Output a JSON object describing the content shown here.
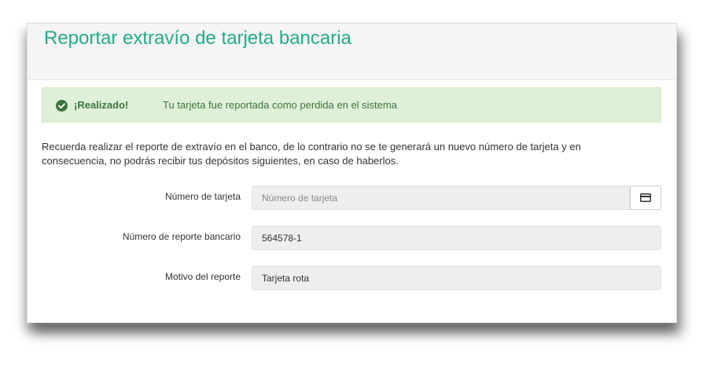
{
  "header": {
    "title": "Reportar extravío de tarjeta bancaria"
  },
  "alert": {
    "icon": "check-circle-icon",
    "title": "¡Realizado!",
    "message": "Tu tarjeta fue reportada como perdida en el sistema",
    "color": "#3c763d",
    "background": "#dff0d8"
  },
  "notice": {
    "text": "Recuerda realizar el reporte de extravío en el banco, de lo contrario no se te generará un nuevo número de tarjeta y en consecuencia, no podrás recibir tus depósitos siguientes, en caso de haberlos."
  },
  "form": {
    "card_number": {
      "label": "Número de tarjeta",
      "value": "",
      "placeholder": "Número de tarjeta",
      "addon_icon": "credit-card-icon"
    },
    "bank_report_number": {
      "label": "Número de reporte bancario",
      "value": "564578-1"
    },
    "report_reason": {
      "label": "Motivo del reporte",
      "value": "Tarjeta rota"
    }
  },
  "colors": {
    "accent": "#26a98b"
  }
}
